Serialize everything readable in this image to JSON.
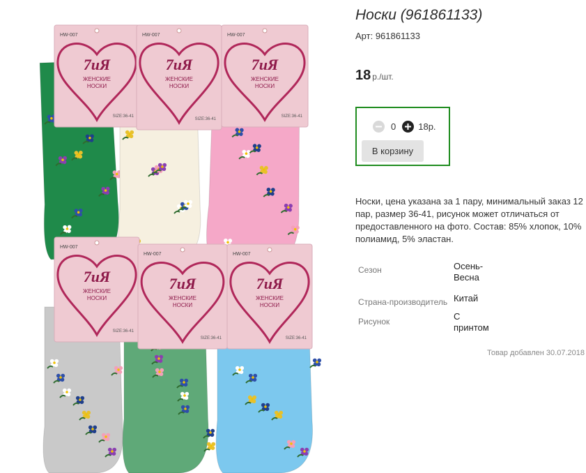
{
  "product": {
    "title": "Носки (961861133)",
    "article_label": "Арт:",
    "article": "961861133",
    "price_value": "18",
    "price_unit": "р./шт.",
    "description": "Носки, цена указана за 1 пару, минимальный заказ 12 пар, размер 36-41, рисунок может отличаться от предоставленного на фото. Состав: 85% хлопок, 10% полиамид, 5% эластан.",
    "added_text": "Товар добавлен 30.07.2018"
  },
  "cart": {
    "minus_icon": "minus-circle-icon",
    "plus_icon": "plus-circle-icon",
    "quantity": "0",
    "sum": "18р.",
    "button_label": "В корзину",
    "border_color": "#1e8c1e"
  },
  "specs": [
    {
      "label": "Сезон",
      "value": "Осень-Весна"
    },
    {
      "label": "Страна-производитель",
      "value": "Китай"
    },
    {
      "label": "Рисунок",
      "value": "С принтом"
    }
  ],
  "image": {
    "brand": "7иЯ",
    "tag_line1": "ЖЕНСКИЕ",
    "tag_line2": "НОСКИ",
    "model_code": "HW-007",
    "size_label": "SIZE:36-41",
    "sock_colors": [
      "#1f8a4a",
      "#f6f0e0",
      "#f5a8c8",
      "#c9c9c9",
      "#5fa978",
      "#7cc8ee"
    ]
  }
}
